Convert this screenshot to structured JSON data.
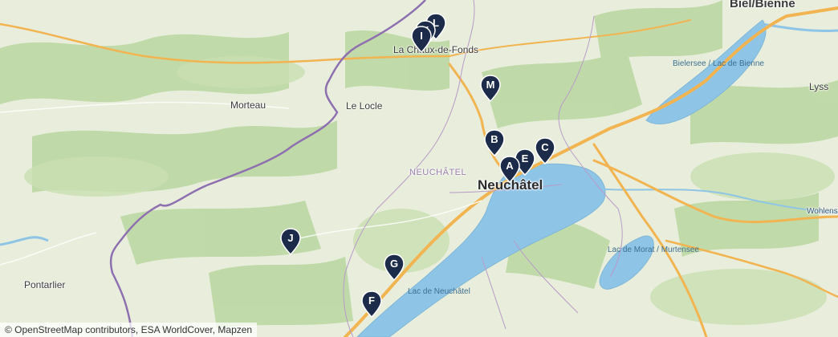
{
  "map": {
    "places": {
      "biel": "Biel/Bienne",
      "chaux_de_fonds": "La Chaux-de-Fonds",
      "morteau": "Morteau",
      "le_locle": "Le Locle",
      "neuchatel_region": "NEUCHÂTEL",
      "neuchatel": "Neuchâtel",
      "lyss": "Lyss",
      "wohlensee": "Wohlensee",
      "pontarlier": "Pontarlier",
      "lac_bienne": "Bielersee / Lac de Bienne",
      "lac_neuchatel": "Lac de Neuchâtel",
      "lac_morat": "Lac de Morat / Murtensee"
    },
    "markers": [
      {
        "id": "A",
        "label": "A"
      },
      {
        "id": "B",
        "label": "B"
      },
      {
        "id": "C",
        "label": "C"
      },
      {
        "id": "E",
        "label": "E"
      },
      {
        "id": "F",
        "label": "F"
      },
      {
        "id": "G",
        "label": "G"
      },
      {
        "id": "I",
        "label": "I"
      },
      {
        "id": "J",
        "label": "J"
      },
      {
        "id": "M",
        "label": "M"
      },
      {
        "id": "K",
        "label": "K"
      },
      {
        "id": "L",
        "label": "L"
      }
    ],
    "attribution": "© OpenStreetMap contributors, ESA WorldCover, Mapzen",
    "colors": {
      "water": "#8ec5e6",
      "land": "#e8eedb",
      "forest": "#b9d5a0",
      "marker": "#1c2b4a",
      "road": "#f2b451",
      "border": "#8e6fb0"
    }
  }
}
